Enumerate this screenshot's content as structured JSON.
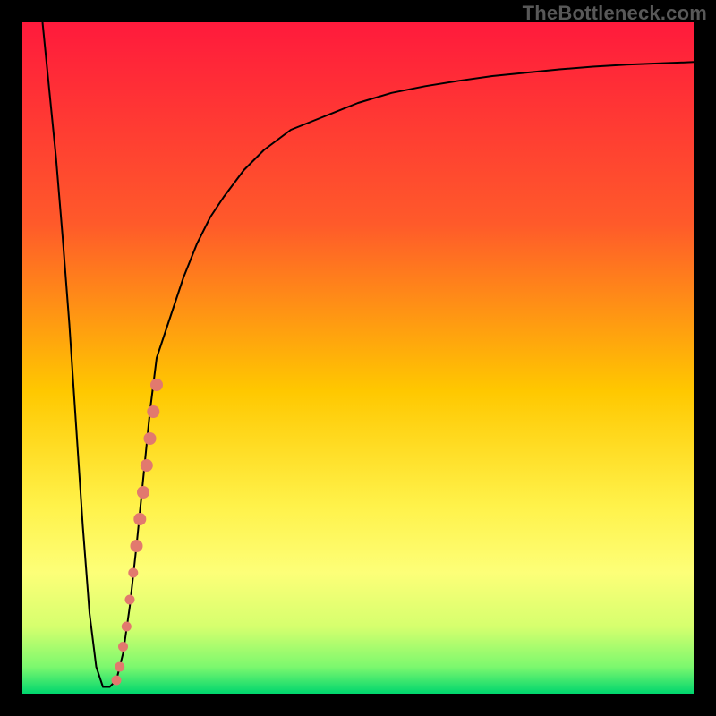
{
  "watermark": "TheBottleneck.com",
  "chart_data": {
    "type": "line",
    "title": "",
    "xlabel": "",
    "ylabel": "",
    "xlim": [
      0,
      100
    ],
    "ylim": [
      0,
      100
    ],
    "grid": false,
    "background_gradient": {
      "stops": [
        {
          "offset": 0.0,
          "color": "#ff1a3c"
        },
        {
          "offset": 0.3,
          "color": "#ff5a2a"
        },
        {
          "offset": 0.55,
          "color": "#ffc800"
        },
        {
          "offset": 0.72,
          "color": "#fff24a"
        },
        {
          "offset": 0.82,
          "color": "#fdff78"
        },
        {
          "offset": 0.9,
          "color": "#d6ff6e"
        },
        {
          "offset": 0.96,
          "color": "#7cf86e"
        },
        {
          "offset": 1.0,
          "color": "#00d66e"
        }
      ]
    },
    "series": [
      {
        "name": "bottleneck-curve",
        "x": [
          3,
          4,
          5,
          6,
          7,
          8,
          9,
          10,
          11,
          12,
          13,
          14,
          15,
          16,
          17,
          18,
          19,
          20,
          22,
          24,
          26,
          28,
          30,
          33,
          36,
          40,
          45,
          50,
          55,
          60,
          65,
          70,
          75,
          80,
          85,
          90,
          95,
          100
        ],
        "y": [
          100,
          90,
          80,
          68,
          55,
          40,
          25,
          12,
          4,
          1,
          1,
          2,
          6,
          13,
          22,
          32,
          42,
          50,
          56,
          62,
          67,
          71,
          74,
          78,
          81,
          84,
          86,
          88,
          89.5,
          90.5,
          91.3,
          92,
          92.5,
          93,
          93.4,
          93.7,
          93.9,
          94.1
        ],
        "stroke": "#000000",
        "stroke_width": 2
      }
    ],
    "scatter": {
      "name": "gpu-points",
      "color": "#e2796e",
      "points": [
        {
          "x": 14.0,
          "y": 2
        },
        {
          "x": 14.5,
          "y": 4
        },
        {
          "x": 15.0,
          "y": 7
        },
        {
          "x": 15.5,
          "y": 10
        },
        {
          "x": 16.0,
          "y": 14
        },
        {
          "x": 16.5,
          "y": 18
        },
        {
          "x": 17.0,
          "y": 22
        },
        {
          "x": 17.5,
          "y": 26
        },
        {
          "x": 18.0,
          "y": 30
        },
        {
          "x": 18.5,
          "y": 34
        },
        {
          "x": 19.0,
          "y": 38
        },
        {
          "x": 19.5,
          "y": 42
        },
        {
          "x": 20.0,
          "y": 46
        }
      ]
    }
  }
}
